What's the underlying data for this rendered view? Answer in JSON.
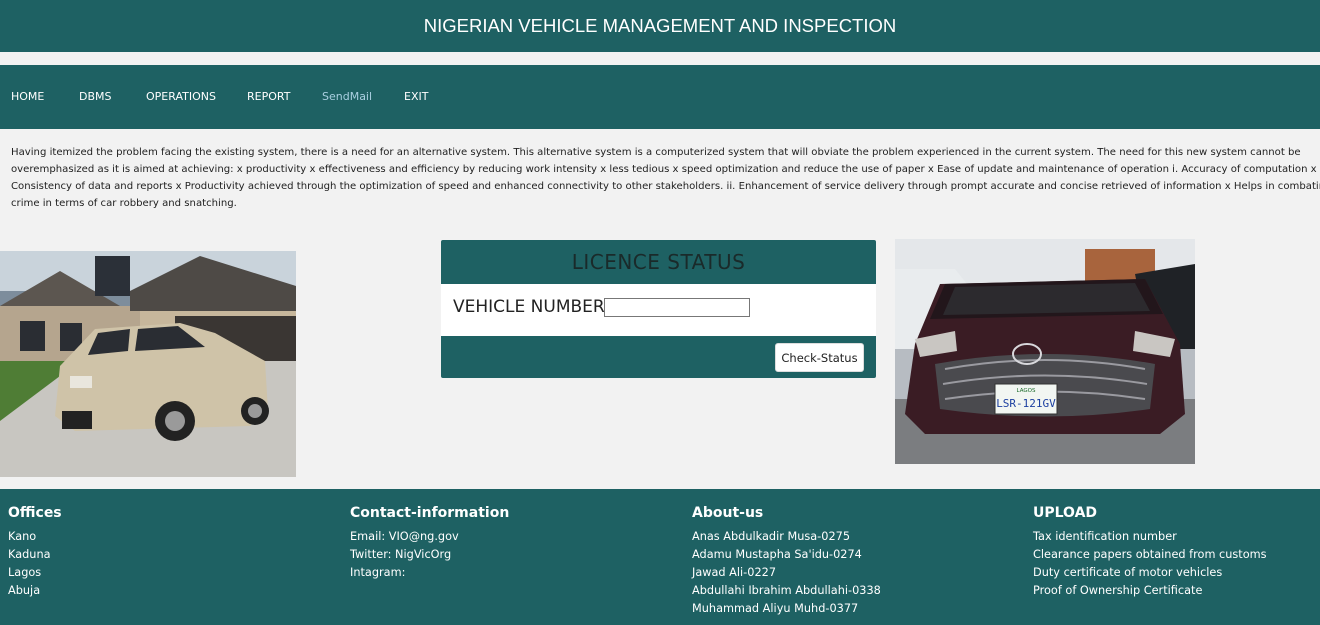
{
  "header": {
    "title": "NIGERIAN VEHICLE MANAGEMENT AND INSPECTION"
  },
  "nav": {
    "items": [
      {
        "label": "HOME"
      },
      {
        "label": "DBMS"
      },
      {
        "label": "OPERATIONS"
      },
      {
        "label": "REPORT"
      },
      {
        "label": "SendMail"
      },
      {
        "label": "EXIT"
      }
    ]
  },
  "intro": {
    "text": "Having itemized the problem facing the existing system, there is a need for an alternative system. This alternative system is a computerized system that will obviate the problem experienced in the current system. The need for this new system cannot be overemphasized as it is aimed at achieving: x productivity x effectiveness and efficiency by reducing work intensity x less tedious x speed optimization and reduce the use of paper x Ease of update and maintenance of operation i. Accuracy of computation x Consistency of data and reports x Productivity achieved through the optimization of speed and enhanced connectivity to other stakeholders. ii. Enhancement of service delivery through prompt accurate and concise retrieved of information x Helps in combating crime in terms of car robbery and snatching."
  },
  "licence": {
    "title": "LICENCE STATUS",
    "vehicle_label": "VEHICLE NUMBER",
    "vehicle_value": "",
    "check_label": "Check-Status"
  },
  "plate": {
    "text": "LSR-121GV",
    "state": "LAGOS"
  },
  "footer": {
    "offices": {
      "title": "Offices",
      "items": [
        "Kano",
        "Kaduna",
        "Lagos",
        "Abuja"
      ]
    },
    "contact": {
      "title": "Contact-information",
      "items": [
        "Email: VIO@ng.gov",
        "Twitter: NigVicOrg",
        "Intagram:"
      ]
    },
    "about": {
      "title": "About-us",
      "items": [
        "Anas Abdulkadir Musa-0275",
        "Adamu Mustapha Sa'idu-0274",
        "Jawad Ali-0227",
        "Abdullahi Ibrahim Abdullahi-0338",
        "Muhammad Aliyu Muhd-0377"
      ]
    },
    "upload": {
      "title": "UPLOAD",
      "items": [
        "Tax identification number",
        "Clearance papers obtained from customs",
        "Duty certificate of motor vehicles",
        "Proof of Ownership Certificate"
      ]
    }
  },
  "colors": {
    "primary": "#1e6163",
    "background": "#f2f2f2",
    "nav_active": "#a9cfe0"
  }
}
